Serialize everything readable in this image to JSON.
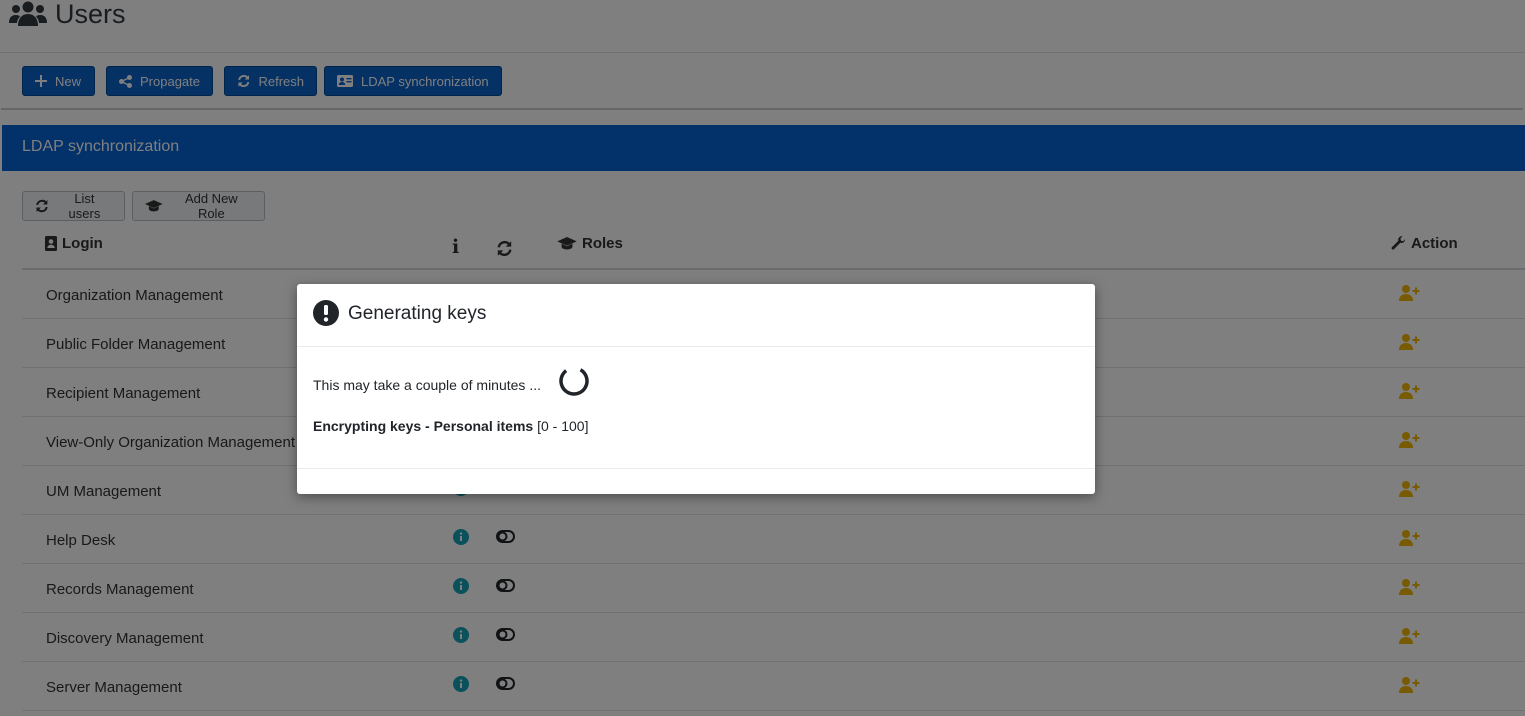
{
  "page": {
    "title": "Users",
    "title_icon": "users-icon"
  },
  "toolbar": {
    "new_label": "New",
    "propagate_label": "Propagate",
    "refresh_label": "Refresh",
    "ldap_label": "LDAP synchronization"
  },
  "section": {
    "title": "LDAP synchronization",
    "list_users_label": "List users",
    "add_role_label": "Add New Role"
  },
  "table": {
    "headers": {
      "login": "Login",
      "info": "i",
      "roles": "Roles",
      "action": "Action"
    },
    "rows": [
      {
        "login": "Organization Management"
      },
      {
        "login": "Public Folder Management"
      },
      {
        "login": "Recipient Management"
      },
      {
        "login": "View-Only Organization Management"
      },
      {
        "login": "UM Management"
      },
      {
        "login": "Help Desk"
      },
      {
        "login": "Records Management"
      },
      {
        "login": "Discovery Management"
      },
      {
        "login": "Server Management"
      }
    ]
  },
  "modal": {
    "title": "Generating keys",
    "message": "This may take a couple of minutes ...",
    "progress_label": "Encrypting keys - Personal items",
    "progress_range": "[0 - 100]"
  },
  "colors": {
    "primary": "#0a63c9",
    "header_blue": "#0762d4",
    "info_teal": "#17a2b8",
    "action_gold": "#f0b400"
  }
}
